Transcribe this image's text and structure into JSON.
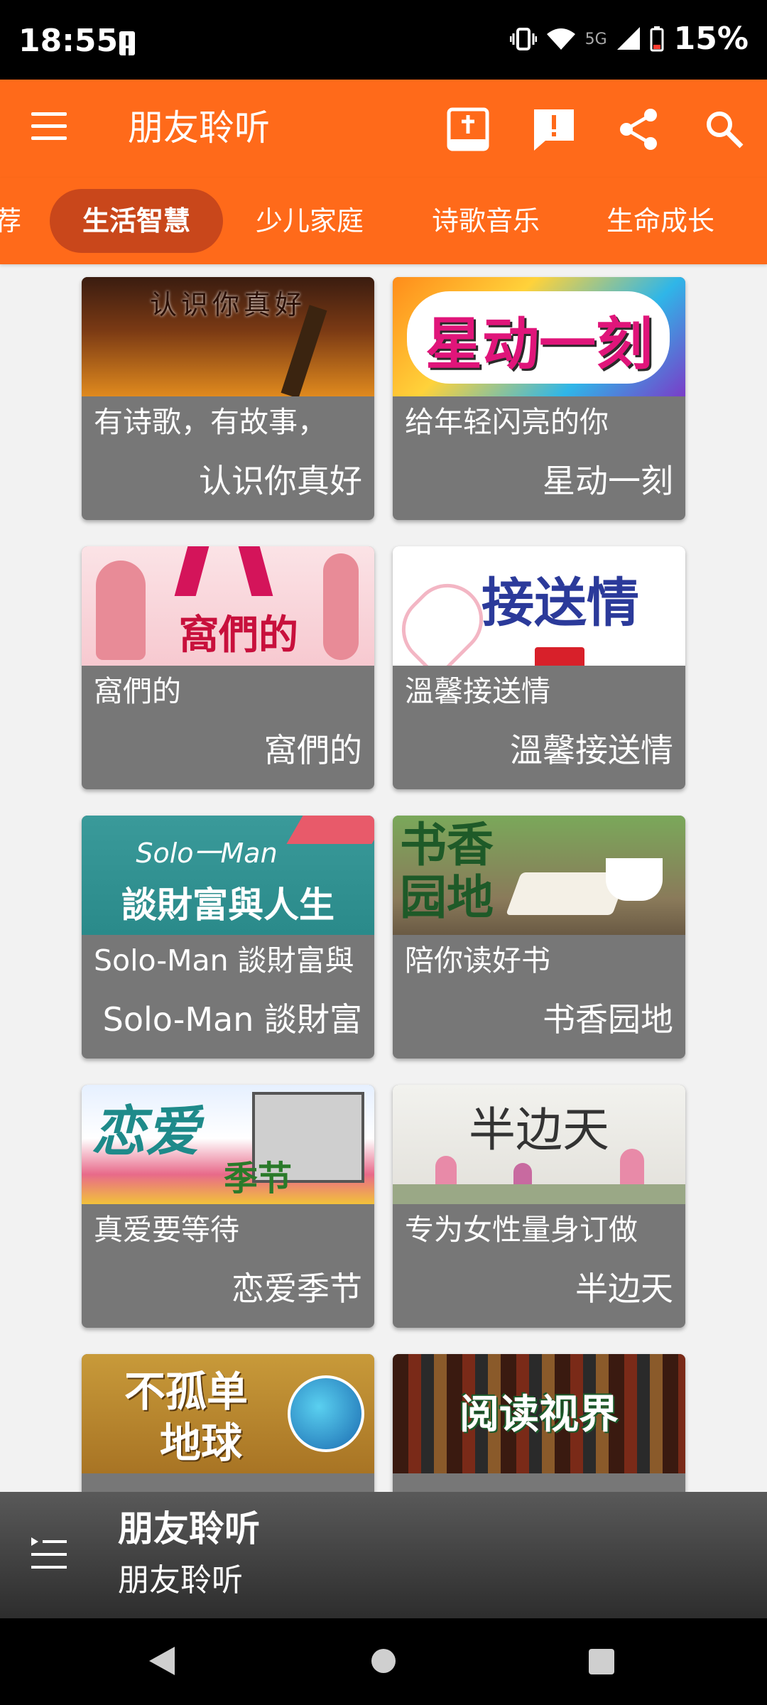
{
  "status_bar": {
    "time": "18:55",
    "network": "5G",
    "battery": "15%"
  },
  "app_bar": {
    "title": "朋友聆听",
    "icons": [
      "menu-icon",
      "bible-icon",
      "report-icon",
      "share-icon",
      "search-icon"
    ]
  },
  "tabs": [
    {
      "label": "荐",
      "active": false
    },
    {
      "label": "生活智慧",
      "active": true
    },
    {
      "label": "少儿家庭",
      "active": false
    },
    {
      "label": "诗歌音乐",
      "active": false
    },
    {
      "label": "生命成长",
      "active": false
    }
  ],
  "cards": [
    {
      "thumb_text": "认识你真好",
      "subtitle": "有诗歌，有故事，",
      "title": "认识你真好"
    },
    {
      "thumb_text": "星动一刻",
      "subtitle": "给年轻闪亮的你",
      "title": "星动一刻"
    },
    {
      "thumb_text": "窩們的",
      "subtitle": "窩們的",
      "title": "窩們的"
    },
    {
      "thumb_text": "接送情",
      "subtitle": "溫馨接送情",
      "title": "溫馨接送情"
    },
    {
      "thumb_text": "Solo一Man",
      "thumb_text2": "談財富與人生",
      "subtitle": "Solo-Man 談財富與",
      "title": "Solo-Man 談財富"
    },
    {
      "thumb_text": "书香",
      "thumb_text2": "园地",
      "subtitle": "陪你读好书",
      "title": "书香园地"
    },
    {
      "thumb_text": "恋爱",
      "thumb_text2": "季节",
      "subtitle": "真爱要等待",
      "title": "恋爱季节"
    },
    {
      "thumb_text": "半边天",
      "subtitle": "专为女性量身订做",
      "title": "半边天"
    },
    {
      "thumb_text": "不孤单",
      "thumb_text2": "地球",
      "subtitle": "",
      "title": ""
    },
    {
      "thumb_text": "阅读视界",
      "subtitle": "",
      "title": ""
    }
  ],
  "now_playing": {
    "title": "朋友聆听",
    "subtitle": "朋友聆听"
  },
  "colors": {
    "accent": "#ff6a1a",
    "tab_active": "#c9471b",
    "card_body": "#777777"
  }
}
